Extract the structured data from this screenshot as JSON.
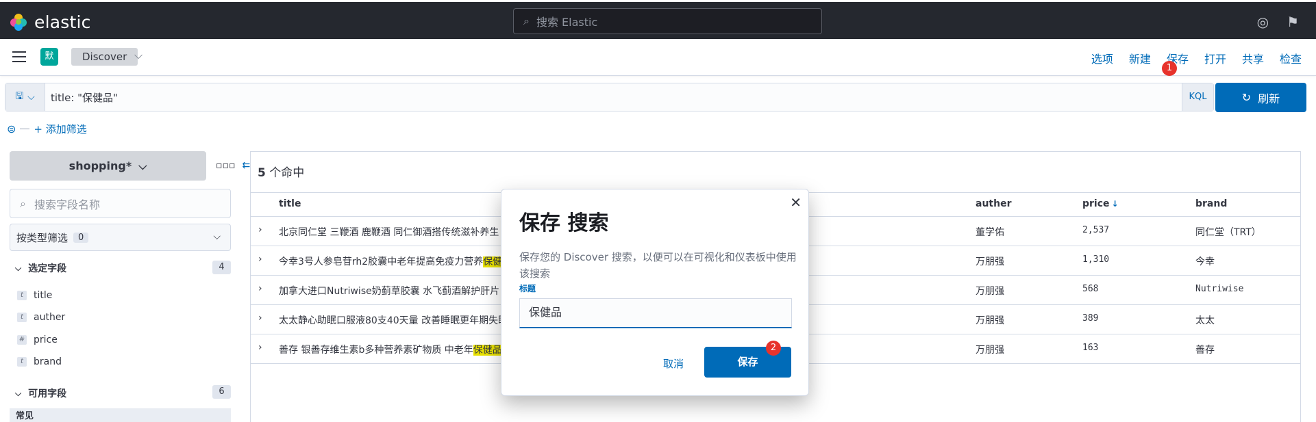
{
  "header": {
    "logo_text": "elastic",
    "search_placeholder": "搜索 Elastic",
    "icons": [
      "help-icon",
      "newsfeed-icon"
    ]
  },
  "toolbar": {
    "space_initial": "默",
    "breadcrumb": "Discover",
    "nav": [
      "选项",
      "新建",
      "保存",
      "打开",
      "共享",
      "检查"
    ],
    "save_badge": "1"
  },
  "query": {
    "text": "title: \"保健品\"",
    "language": "KQL",
    "refresh_label": "刷新",
    "add_filter_label": "+ 添加筛选"
  },
  "sidebar": {
    "index_pattern": "shopping*",
    "field_search_placeholder": "搜索字段名称",
    "type_filter_label": "按类型筛选",
    "type_filter_count": "0",
    "selected_label": "选定字段",
    "selected_count": "4",
    "selected_fields": [
      {
        "type": "t",
        "name": "title"
      },
      {
        "type": "t",
        "name": "auther"
      },
      {
        "type": "#",
        "name": "price"
      },
      {
        "type": "t",
        "name": "brand"
      }
    ],
    "available_label": "可用字段",
    "available_count": "6",
    "common_label": "常见"
  },
  "results": {
    "hit_count": "5",
    "hit_suffix": " 个命中",
    "columns": [
      "title",
      "auther",
      "price",
      "brand"
    ],
    "rows": [
      {
        "title": "北京同仁堂 三鞭酒 鹿鞭酒 同仁御酒搭传统滋补养生",
        "title_hl": "",
        "auther": "董学佑",
        "price": "2,537",
        "brand": "同仁堂（TRT）"
      },
      {
        "title": "今幸3号人参皂苷rh2胶囊中老年提高免疫力营养",
        "title_hl": "保健",
        "auther": "万朋强",
        "price": "1,310",
        "brand": "今幸"
      },
      {
        "title": "加拿大进口Nutriwise奶蓟草胶囊 水飞蓟酒解护肝片",
        "title_hl": "",
        "auther": "万朋强",
        "price": "568",
        "brand": "Nutriwise"
      },
      {
        "title": "太太静心助眠口服液80支40天量 改善睡眠更年期失眠",
        "title_hl": "",
        "auther": "万朋强",
        "price": "389",
        "brand": "太太"
      },
      {
        "title": "善存 银善存维生素b多种营养素矿物质 中老年",
        "title_hl": "保健品",
        "auther": "万朋强",
        "price": "163",
        "brand": "善存"
      }
    ]
  },
  "modal": {
    "title": "保存 搜索",
    "description": "保存您的 Discover 搜索，以便可以在可视化和仪表板中使用该搜索",
    "field_label": "标题",
    "field_value": "保健品",
    "cancel_label": "取消",
    "save_label": "保存",
    "save_badge": "2"
  }
}
